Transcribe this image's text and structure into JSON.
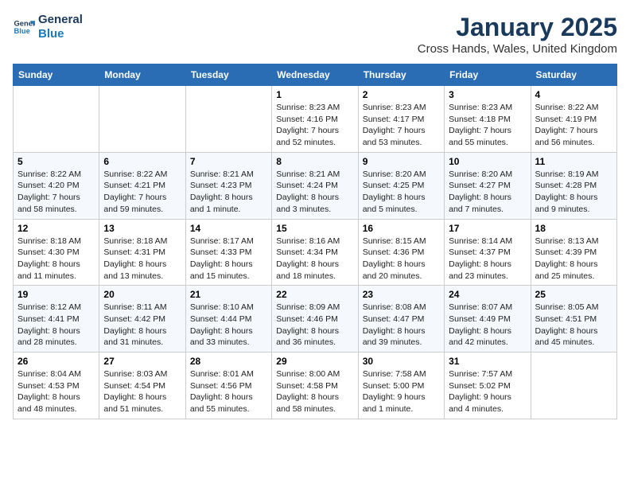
{
  "logo": {
    "line1": "General",
    "line2": "Blue"
  },
  "title": "January 2025",
  "subtitle": "Cross Hands, Wales, United Kingdom",
  "weekdays": [
    "Sunday",
    "Monday",
    "Tuesday",
    "Wednesday",
    "Thursday",
    "Friday",
    "Saturday"
  ],
  "weeks": [
    [
      {
        "day": "",
        "info": ""
      },
      {
        "day": "",
        "info": ""
      },
      {
        "day": "",
        "info": ""
      },
      {
        "day": "1",
        "info": "Sunrise: 8:23 AM\nSunset: 4:16 PM\nDaylight: 7 hours and 52 minutes."
      },
      {
        "day": "2",
        "info": "Sunrise: 8:23 AM\nSunset: 4:17 PM\nDaylight: 7 hours and 53 minutes."
      },
      {
        "day": "3",
        "info": "Sunrise: 8:23 AM\nSunset: 4:18 PM\nDaylight: 7 hours and 55 minutes."
      },
      {
        "day": "4",
        "info": "Sunrise: 8:22 AM\nSunset: 4:19 PM\nDaylight: 7 hours and 56 minutes."
      }
    ],
    [
      {
        "day": "5",
        "info": "Sunrise: 8:22 AM\nSunset: 4:20 PM\nDaylight: 7 hours and 58 minutes."
      },
      {
        "day": "6",
        "info": "Sunrise: 8:22 AM\nSunset: 4:21 PM\nDaylight: 7 hours and 59 minutes."
      },
      {
        "day": "7",
        "info": "Sunrise: 8:21 AM\nSunset: 4:23 PM\nDaylight: 8 hours and 1 minute."
      },
      {
        "day": "8",
        "info": "Sunrise: 8:21 AM\nSunset: 4:24 PM\nDaylight: 8 hours and 3 minutes."
      },
      {
        "day": "9",
        "info": "Sunrise: 8:20 AM\nSunset: 4:25 PM\nDaylight: 8 hours and 5 minutes."
      },
      {
        "day": "10",
        "info": "Sunrise: 8:20 AM\nSunset: 4:27 PM\nDaylight: 8 hours and 7 minutes."
      },
      {
        "day": "11",
        "info": "Sunrise: 8:19 AM\nSunset: 4:28 PM\nDaylight: 8 hours and 9 minutes."
      }
    ],
    [
      {
        "day": "12",
        "info": "Sunrise: 8:18 AM\nSunset: 4:30 PM\nDaylight: 8 hours and 11 minutes."
      },
      {
        "day": "13",
        "info": "Sunrise: 8:18 AM\nSunset: 4:31 PM\nDaylight: 8 hours and 13 minutes."
      },
      {
        "day": "14",
        "info": "Sunrise: 8:17 AM\nSunset: 4:33 PM\nDaylight: 8 hours and 15 minutes."
      },
      {
        "day": "15",
        "info": "Sunrise: 8:16 AM\nSunset: 4:34 PM\nDaylight: 8 hours and 18 minutes."
      },
      {
        "day": "16",
        "info": "Sunrise: 8:15 AM\nSunset: 4:36 PM\nDaylight: 8 hours and 20 minutes."
      },
      {
        "day": "17",
        "info": "Sunrise: 8:14 AM\nSunset: 4:37 PM\nDaylight: 8 hours and 23 minutes."
      },
      {
        "day": "18",
        "info": "Sunrise: 8:13 AM\nSunset: 4:39 PM\nDaylight: 8 hours and 25 minutes."
      }
    ],
    [
      {
        "day": "19",
        "info": "Sunrise: 8:12 AM\nSunset: 4:41 PM\nDaylight: 8 hours and 28 minutes."
      },
      {
        "day": "20",
        "info": "Sunrise: 8:11 AM\nSunset: 4:42 PM\nDaylight: 8 hours and 31 minutes."
      },
      {
        "day": "21",
        "info": "Sunrise: 8:10 AM\nSunset: 4:44 PM\nDaylight: 8 hours and 33 minutes."
      },
      {
        "day": "22",
        "info": "Sunrise: 8:09 AM\nSunset: 4:46 PM\nDaylight: 8 hours and 36 minutes."
      },
      {
        "day": "23",
        "info": "Sunrise: 8:08 AM\nSunset: 4:47 PM\nDaylight: 8 hours and 39 minutes."
      },
      {
        "day": "24",
        "info": "Sunrise: 8:07 AM\nSunset: 4:49 PM\nDaylight: 8 hours and 42 minutes."
      },
      {
        "day": "25",
        "info": "Sunrise: 8:05 AM\nSunset: 4:51 PM\nDaylight: 8 hours and 45 minutes."
      }
    ],
    [
      {
        "day": "26",
        "info": "Sunrise: 8:04 AM\nSunset: 4:53 PM\nDaylight: 8 hours and 48 minutes."
      },
      {
        "day": "27",
        "info": "Sunrise: 8:03 AM\nSunset: 4:54 PM\nDaylight: 8 hours and 51 minutes."
      },
      {
        "day": "28",
        "info": "Sunrise: 8:01 AM\nSunset: 4:56 PM\nDaylight: 8 hours and 55 minutes."
      },
      {
        "day": "29",
        "info": "Sunrise: 8:00 AM\nSunset: 4:58 PM\nDaylight: 8 hours and 58 minutes."
      },
      {
        "day": "30",
        "info": "Sunrise: 7:58 AM\nSunset: 5:00 PM\nDaylight: 9 hours and 1 minute."
      },
      {
        "day": "31",
        "info": "Sunrise: 7:57 AM\nSunset: 5:02 PM\nDaylight: 9 hours and 4 minutes."
      },
      {
        "day": "",
        "info": ""
      }
    ]
  ]
}
